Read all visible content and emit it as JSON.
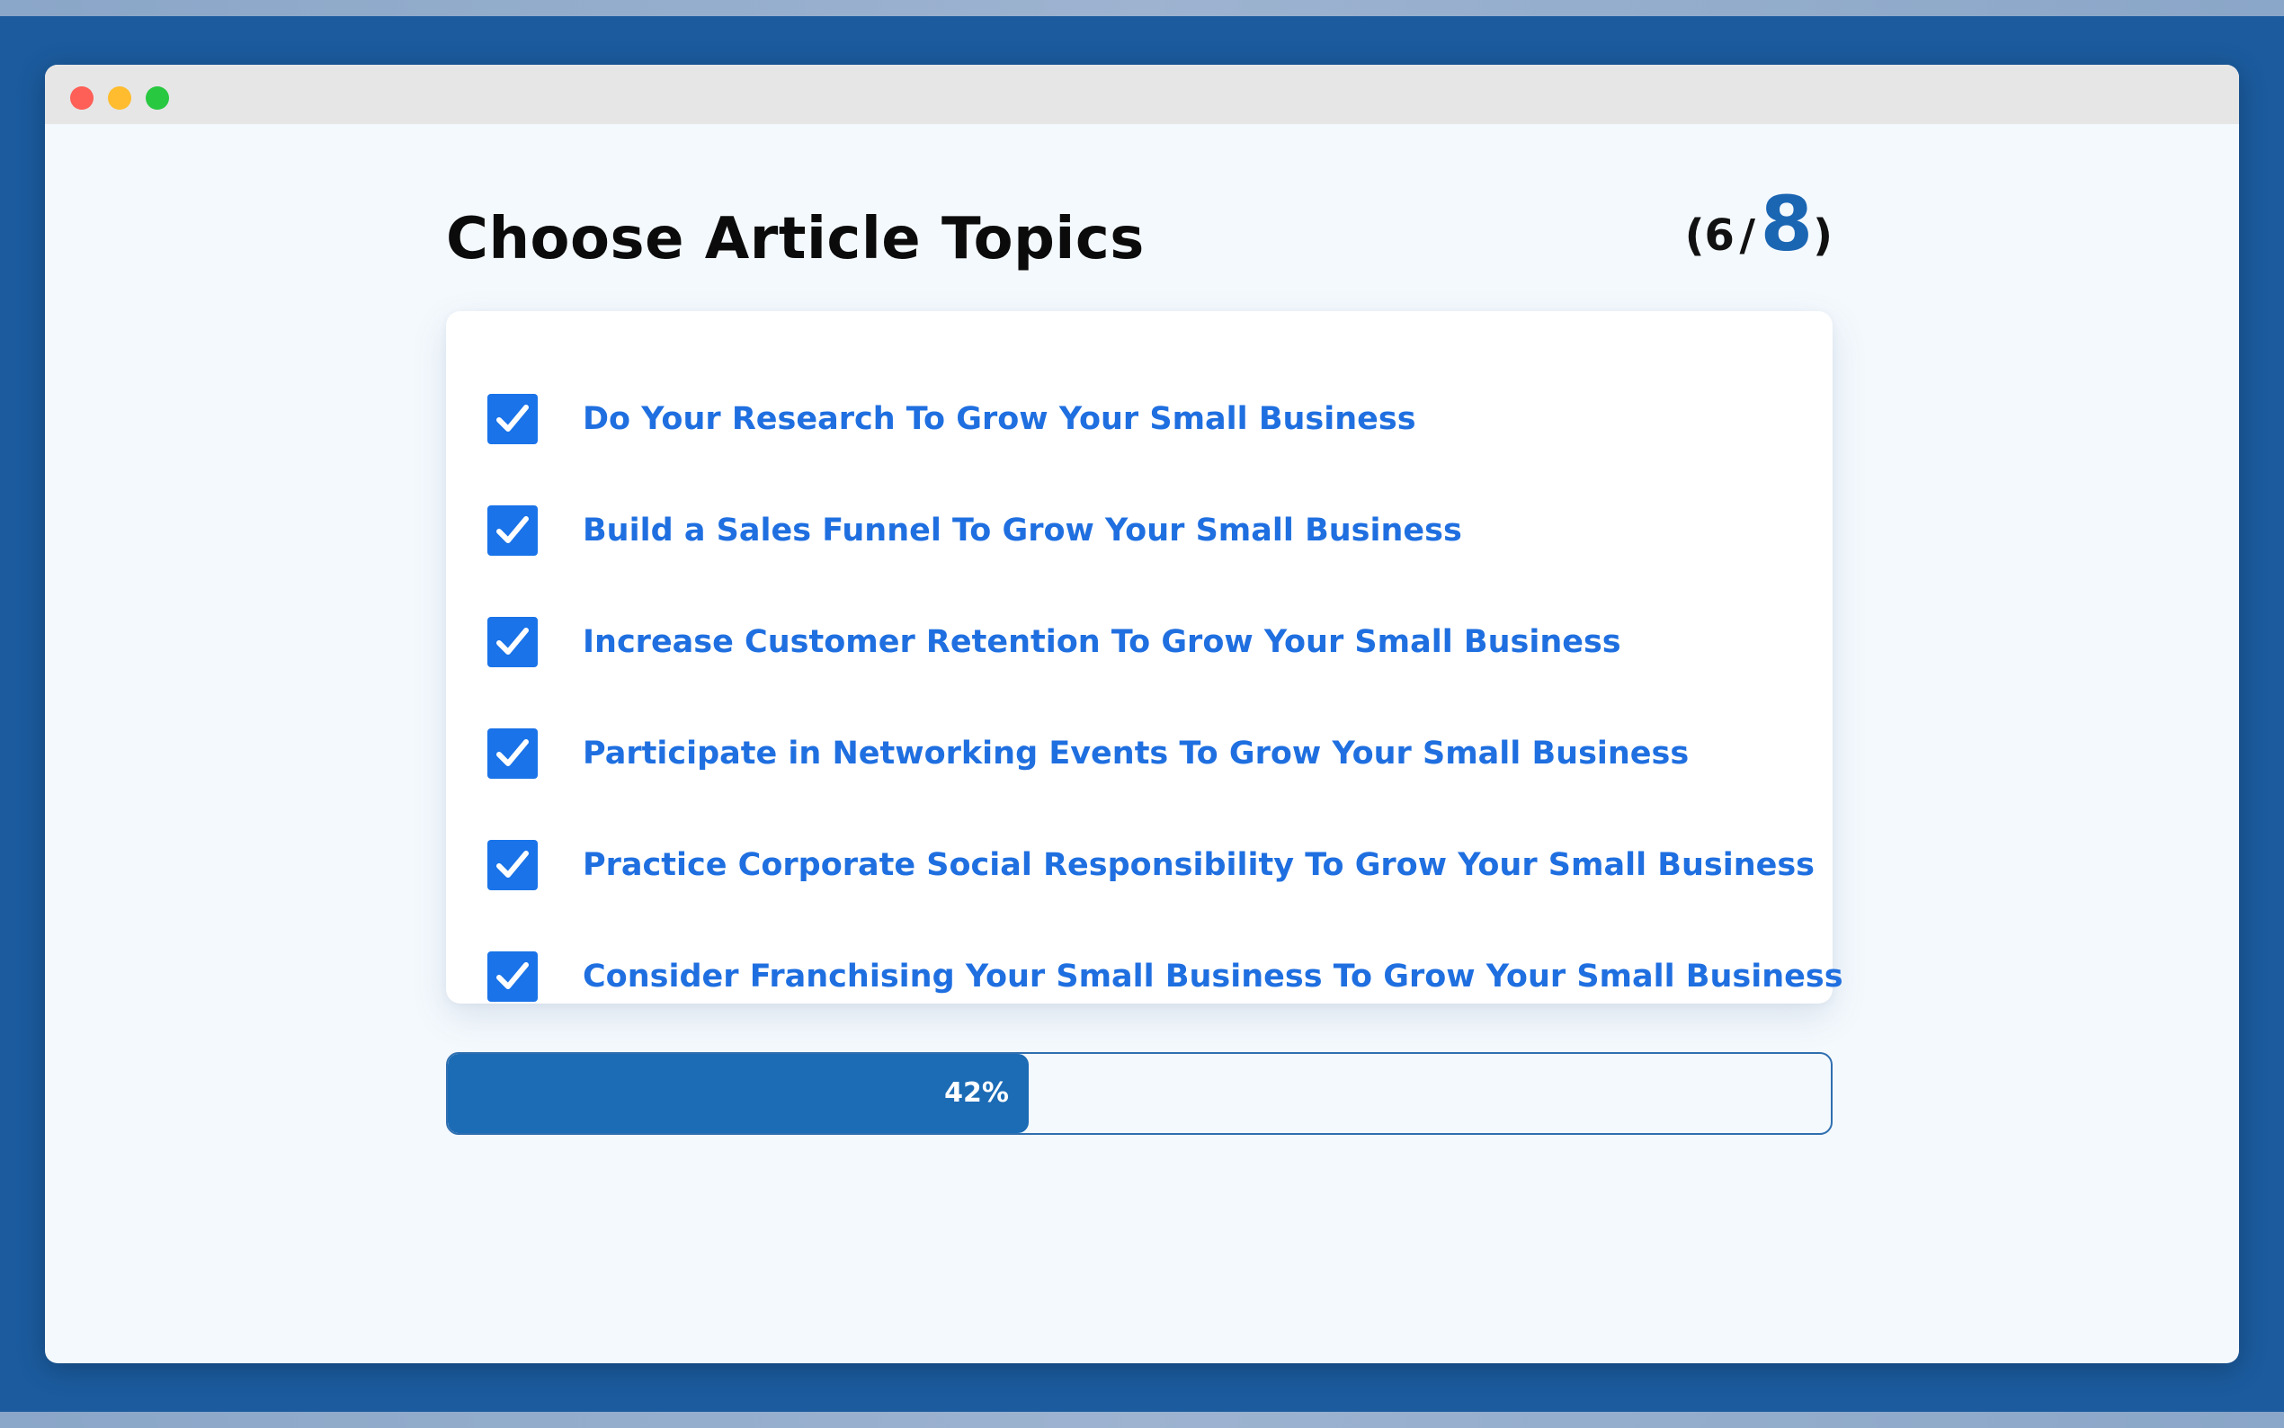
{
  "page": {
    "title": "Choose Article Topics",
    "counter": {
      "open": "(",
      "selected": "6",
      "separator": "/",
      "total": "8",
      "close": ")"
    }
  },
  "topics": [
    {
      "label": "Do Your Research To Grow Your Small Business",
      "checked": true
    },
    {
      "label": "Build a Sales Funnel To Grow Your Small Business",
      "checked": true
    },
    {
      "label": "Increase Customer Retention To Grow Your Small Business",
      "checked": true
    },
    {
      "label": "Participate in Networking Events To Grow Your Small Business",
      "checked": true
    },
    {
      "label": "Practice Corporate Social Responsibility To Grow Your Small Business",
      "checked": true
    },
    {
      "label": "Consider Franchising Your Small Business To Grow Your Small Business",
      "checked": true
    }
  ],
  "progress": {
    "percent": 42,
    "label": "42%"
  },
  "window": {
    "controls": [
      "close-button",
      "minimize-button",
      "maximize-button"
    ]
  },
  "colors": {
    "background": "#1b5b9e",
    "window": "#f4f9fd",
    "accent": "#1b66b3",
    "checkbox": "#1a73e8",
    "topic_text": "#1f6fe0",
    "progress_fill": "#1b6bb5"
  }
}
